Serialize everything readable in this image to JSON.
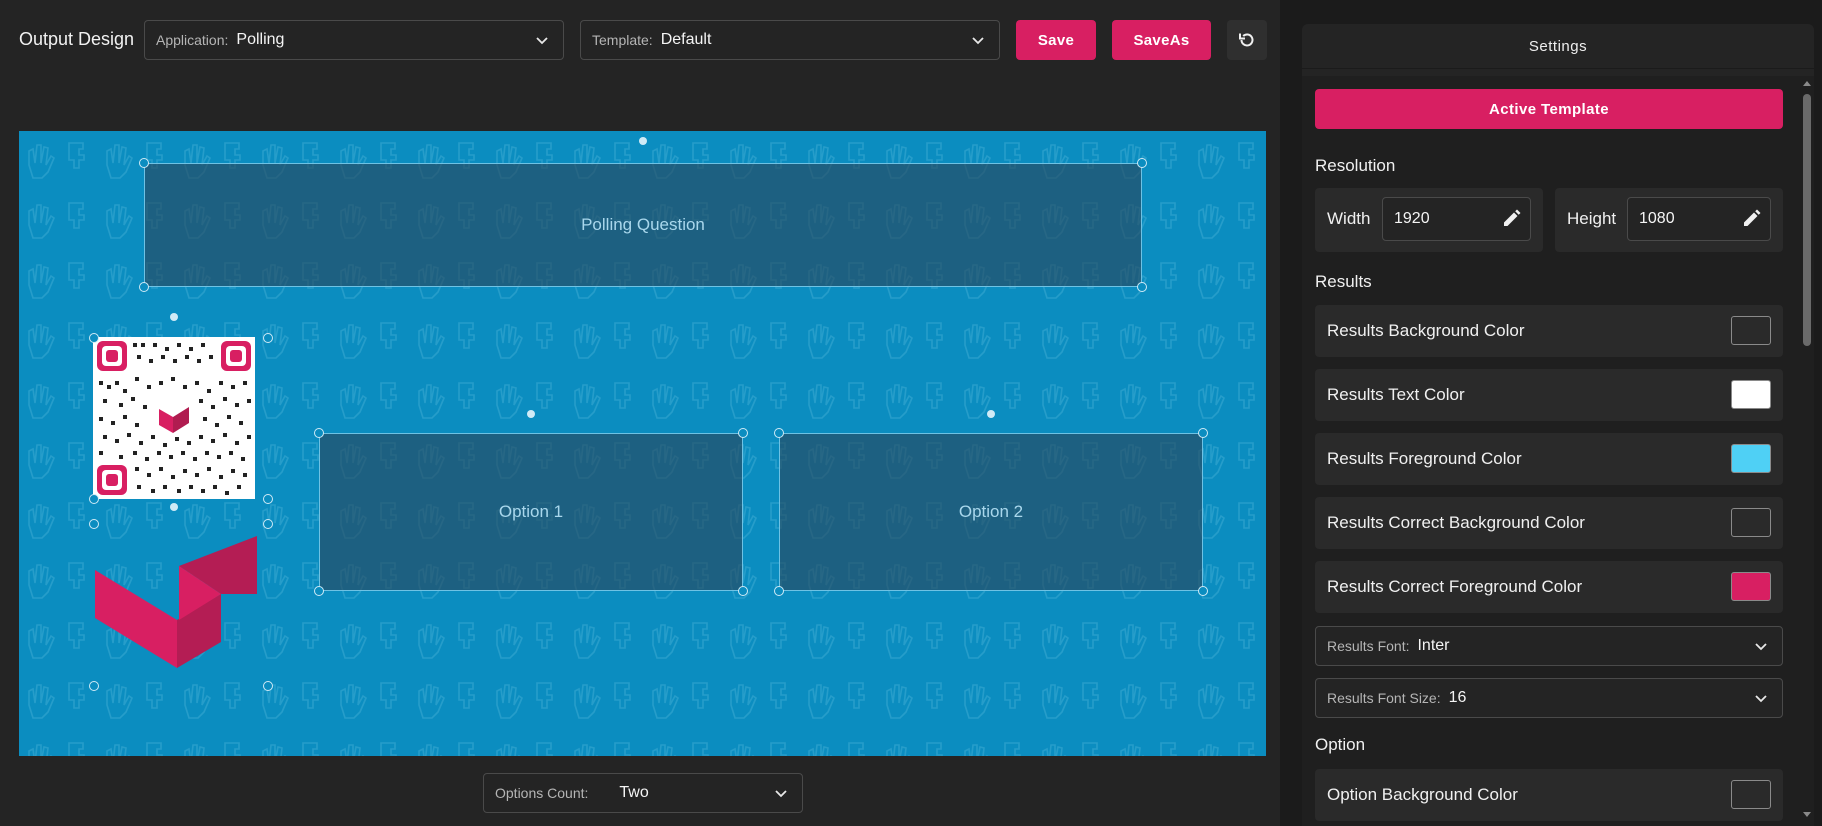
{
  "toolbar": {
    "title": "Output Design",
    "application": {
      "label": "Application:",
      "value": "Polling"
    },
    "template": {
      "label": "Template:",
      "value": "Default"
    },
    "save_label": "Save",
    "saveas_label": "SaveAs",
    "reset_icon": "rotate-ccw-icon"
  },
  "canvas": {
    "background_color": "#0b8dc0",
    "question_label": "Polling Question",
    "option1_label": "Option 1",
    "option2_label": "Option 2"
  },
  "footer": {
    "options_count": {
      "label": "Options Count:",
      "value": "Two"
    }
  },
  "settings": {
    "title": "Settings",
    "active_template_label": "Active Template",
    "resolution": {
      "title": "Resolution",
      "width_label": "Width",
      "width_value": "1920",
      "height_label": "Height",
      "height_value": "1080"
    },
    "results": {
      "title": "Results",
      "colors": [
        {
          "label": "Results Background Color",
          "color": "#2a2a2a"
        },
        {
          "label": "Results Text Color",
          "color": "#ffffff"
        },
        {
          "label": "Results Foreground Color",
          "color": "#4fd0f5"
        },
        {
          "label": "Results Correct Background Color",
          "color": "#2a2a2a"
        },
        {
          "label": "Results Correct Foreground Color",
          "color": "#d81f62"
        }
      ],
      "font": {
        "label": "Results Font:",
        "value": "Inter"
      },
      "font_size": {
        "label": "Results Font Size:",
        "value": "16"
      }
    },
    "option": {
      "title": "Option",
      "colors": [
        {
          "label": "Option Background Color",
          "color": "#2a2a2a"
        }
      ]
    }
  },
  "colors": {
    "accent": "#d81f62",
    "panel": "#242424",
    "canvas": "#0b8dc0"
  }
}
